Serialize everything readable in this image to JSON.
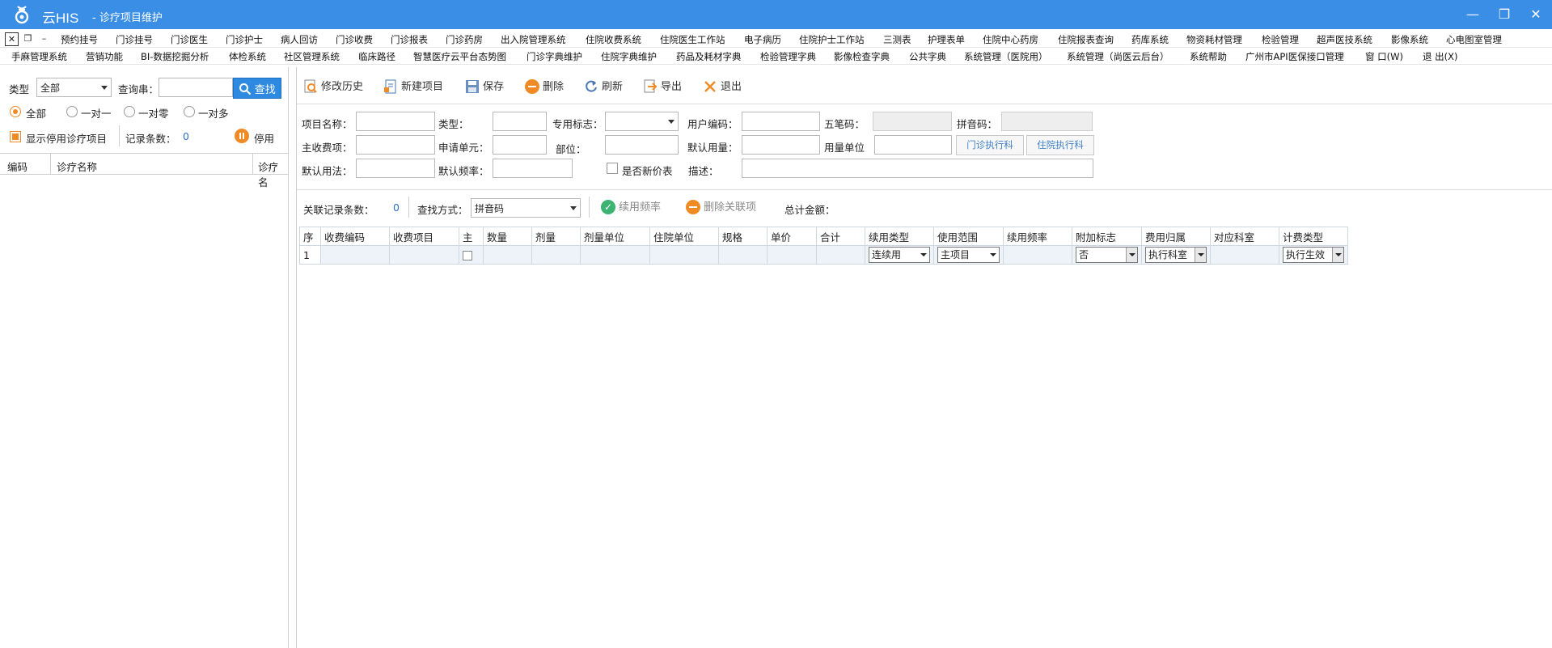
{
  "window": {
    "app_name": "云HIS",
    "subtitle": "- 诊疗项目维护"
  },
  "menu_row1": [
    "预约挂号",
    "门诊挂号",
    "门诊医生",
    "门诊护士",
    "病人回访",
    "门诊收费",
    "门诊报表",
    "门诊药房",
    "出入院管理系统",
    "住院收费系统",
    "住院医生工作站",
    "电子病历",
    "住院护士工作站",
    "三测表",
    "护理表单",
    "住院中心药房",
    "住院报表查询",
    "药库系统",
    "物资耗材管理",
    "检验管理",
    "超声医技系统",
    "影像系统",
    "心电图室管理"
  ],
  "menu_row2": [
    "手麻管理系统",
    "营销功能",
    "BI-数据挖掘分析",
    "体检系统",
    "社区管理系统",
    "临床路径",
    "智慧医疗云平台态势图",
    "门诊字典维护",
    "住院字典维护",
    "药品及耗材字典",
    "检验管理字典",
    "影像检查字典",
    "公共字典",
    "系统管理（医院用）",
    "系统管理（尚医云后台）",
    "系统帮助",
    "广州市API医保接口管理",
    "窗 口(W)",
    "退 出(X)"
  ],
  "left": {
    "type_label": "类型",
    "type_value": "全部",
    "query_label": "查询串：",
    "query_value": "",
    "find_button": "查找",
    "radios": [
      "全部",
      "一对一",
      "一对零",
      "一对多"
    ],
    "radio_selected": 0,
    "show_disabled_label": "显示停用诊疗项目",
    "record_count_label": "记录条数：",
    "record_count": "0",
    "disable_label": "停用",
    "grid_headers": [
      "编码",
      "诊疗名称",
      "诊疗名"
    ]
  },
  "toolbar": {
    "history": "修改历史",
    "new_item": "新建项目",
    "save": "保存",
    "delete": "删除",
    "refresh": "刷新",
    "export": "导出",
    "exit": "退出"
  },
  "form": {
    "item_name": "项目名称：",
    "type": "类型：",
    "special_flag": "专用标志：",
    "user_code": "用户编码：",
    "wubi": "五笔码：",
    "pinyin": "拼音码：",
    "main_fee": "主收费项：",
    "request_unit": "申请单元：",
    "site": "部位：",
    "default_dose": "默认用量：",
    "dose_unit": "用量单位",
    "outpatient_dept_btn": "门诊执行科",
    "inpatient_dept_btn": "住院执行科",
    "default_usage": "默认用法：",
    "default_freq": "默认频率：",
    "new_price_label": "是否新价表",
    "description": "描述："
  },
  "relbar": {
    "count_label": "关联记录条数：",
    "count": "0",
    "search_mode_label": "查找方式：",
    "search_mode_value": "拼音码",
    "continue_freq": "续用频率",
    "delete_link": "删除关联项",
    "total_label": "总计金额："
  },
  "grid": {
    "headers": [
      "序",
      "收费编码",
      "收费项目",
      "主",
      "数量",
      "剂量",
      "剂量单位",
      "住院单位",
      "规格",
      "单价",
      "合计",
      "续用类型",
      "使用范围",
      "续用频率",
      "附加标志",
      "费用归属",
      "对应科室",
      "计费类型"
    ],
    "rows": [
      {
        "seq": "1",
        "continue_type": "连续用",
        "use_scope": "主项目",
        "extra_flag": "否",
        "fee_owner": "执行科室",
        "billing_type": "执行生效"
      }
    ]
  }
}
